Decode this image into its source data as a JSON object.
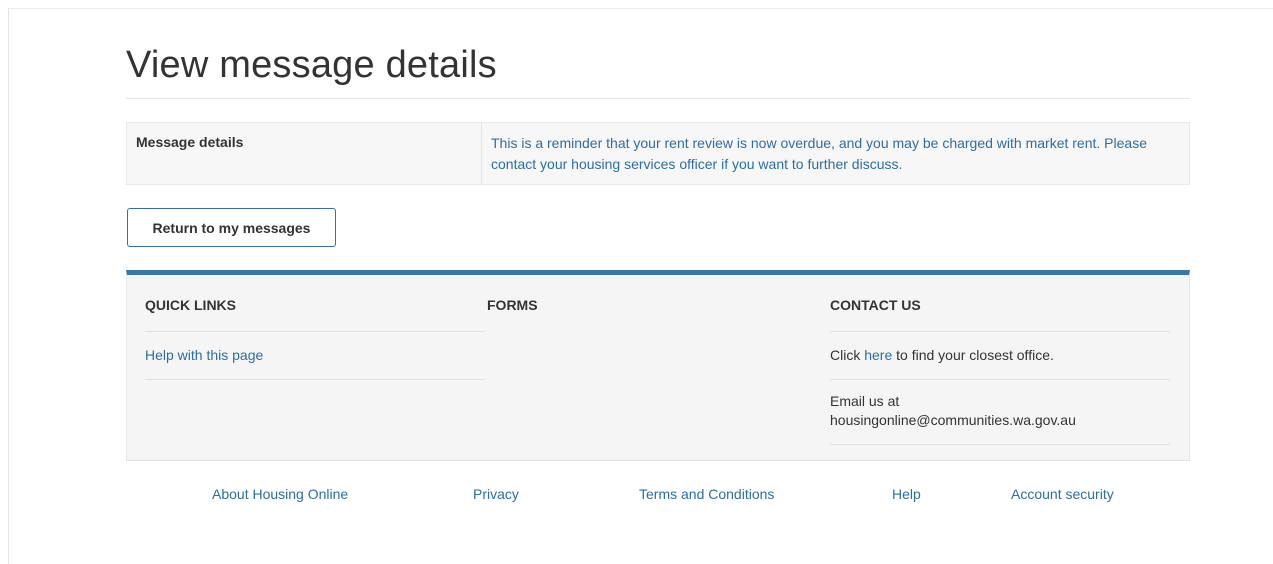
{
  "page": {
    "title": "View message details"
  },
  "message": {
    "label": "Message details",
    "text": "This is a reminder that your rent review is now overdue, and you may be charged with market rent. Please contact your housing services officer if you want to further discuss."
  },
  "actions": {
    "return_label": "Return to my messages"
  },
  "footer": {
    "quick_links": {
      "heading": "QUICK LINKS",
      "items": [
        "Help with this page"
      ]
    },
    "forms": {
      "heading": "FORMS"
    },
    "contact": {
      "heading": "CONTACT US",
      "office_prefix": "Click ",
      "office_link": "here",
      "office_suffix": " to find your closest office.",
      "email_prefix": "Email us at",
      "email": "housingonline@communities.wa.gov.au"
    }
  },
  "bottom_links": [
    "About Housing Online",
    "Privacy",
    "Terms and Conditions",
    "Help",
    "Account security"
  ],
  "colors": {
    "accent": "#3b78a8",
    "link": "#2e6da4"
  }
}
